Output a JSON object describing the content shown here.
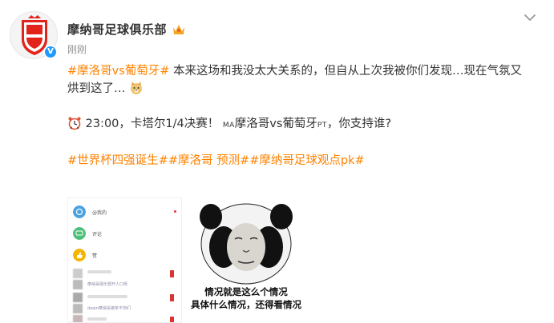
{
  "user": {
    "name": "摩纳哥足球俱乐部",
    "time": "刚刚"
  },
  "post": {
    "line1_topic": "#摩洛哥vs葡萄牙#",
    "line1_text": " 本来这场和我没太大关系的，但自从上次我被你们发现…现在气氛又",
    "line2_text": "烘到这了…",
    "match_time": "23:00，卡塔尔1/4决赛！",
    "team_a_code": "MA",
    "team_a": "摩洛哥vs葡萄牙",
    "team_b_code": "PT",
    "question": "，你支持谁?",
    "tag1": "#世界杯四强诞生#",
    "tag2": "#摩洛哥 预测#",
    "tag3": "#摩纳哥足球观点pk#"
  },
  "image1": {
    "menu": [
      {
        "label": "@我的",
        "icon": "at-icon",
        "color": "#4aa3e0"
      },
      {
        "label": "评论",
        "icon": "comment-icon",
        "color": "#4cbf7a"
      },
      {
        "label": "赞",
        "icon": "like-icon",
        "color": "#f5b400"
      }
    ],
    "row_texts": [
      "摩纳哥俱乐部开人口呀",
      "daqin摩纳哥被单不你们"
    ]
  },
  "image2": {
    "caption1": "情况就是这么个情况",
    "caption2": "具体什么情况，还得看情况"
  },
  "colors": {
    "topic": "#ff8200",
    "verified": "#1e9bff"
  }
}
